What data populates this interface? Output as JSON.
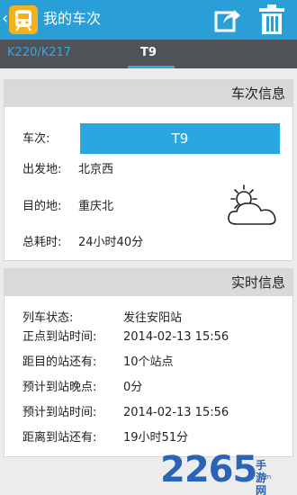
{
  "header": {
    "back_glyph": "‹",
    "title": "我的车次",
    "share_icon": "share-icon",
    "trash_icon": "trash-icon",
    "bar_color": "#2a9ed6"
  },
  "tabs": [
    {
      "label": "K220/K217",
      "active": false
    },
    {
      "label": "T9",
      "active": true
    }
  ],
  "train_info": {
    "section_title": "车次信息",
    "train_label": "车次:",
    "train_number": "T9",
    "depart_label": "出发地:",
    "depart_value": "北京西",
    "dest_label": "目的地:",
    "dest_value": "重庆北",
    "duration_label": "总耗时:",
    "duration_value": "24小时40分",
    "weather_icon": "partly-cloudy-icon"
  },
  "realtime": {
    "section_title": "实时信息",
    "rows": [
      {
        "label": "列车状态:",
        "value": "发往安阳站"
      },
      {
        "label": "正点到站时间:",
        "value": "2014-02-13 15:56"
      },
      {
        "label": "距目的站还有:",
        "value": "10个站点"
      },
      {
        "label": "预计到站晚点:",
        "value": "0分"
      },
      {
        "label": "预计到站时间:",
        "value": "2014-02-13 15:56"
      },
      {
        "label": "距离到站还有:",
        "value": "19小时51分"
      }
    ]
  },
  "watermark": {
    "number": "2265",
    "dot_com": ".com",
    "name": "手游网"
  }
}
